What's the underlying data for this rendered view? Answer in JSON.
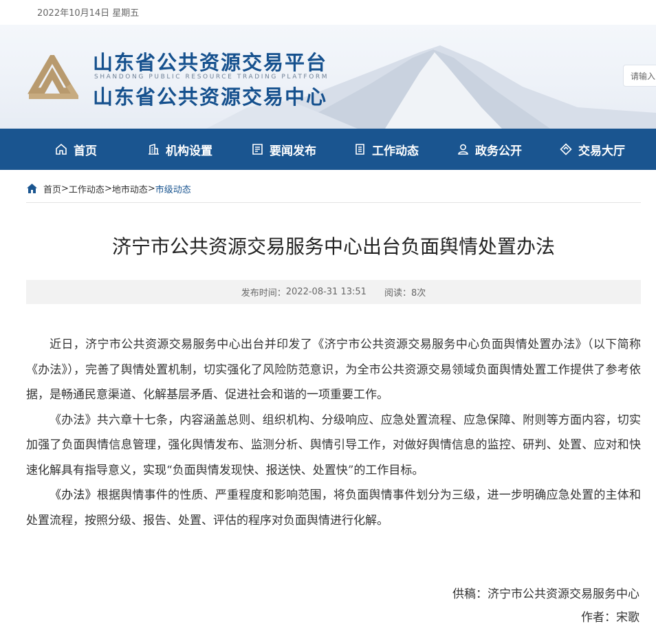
{
  "topbar": {
    "date": "2022年10月14日 星期五"
  },
  "header": {
    "title_cn_1": "山东省公共资源交易平台",
    "title_en": "SHANDONG PUBLIC RESOURCE TRADING PLATFORM",
    "title_cn_2": "山东省公共资源交易中心",
    "search_placeholder": "请输入"
  },
  "nav": {
    "items": [
      {
        "label": "首页",
        "icon": "home-icon"
      },
      {
        "label": "机构设置",
        "icon": "building-icon"
      },
      {
        "label": "要闻发布",
        "icon": "news-icon"
      },
      {
        "label": "工作动态",
        "icon": "document-icon"
      },
      {
        "label": "政务公开",
        "icon": "user-icon"
      },
      {
        "label": "交易大厅",
        "icon": "diamond-icon"
      }
    ]
  },
  "breadcrumb": {
    "items": [
      "首页",
      "工作动态",
      "地市动态",
      "市级动态"
    ],
    "separator": ">"
  },
  "article": {
    "title": "济宁市公共资源交易服务中心出台负面舆情处置办法",
    "publish_label": "发布时间：",
    "publish_time": "2022-08-31 13:51",
    "reads_label": "阅读：",
    "reads_count": "8次",
    "paragraphs": [
      {
        "text": "近日，济宁市公共资源交易服务中心出台并印发了《济宁市公共资源交易服务中心负面舆情处置办法》（以下简称《办法》），完善了舆情处置机制，切实强化了风险防范意识，为全市公共资源交易领域负面舆情处置工作提供了参考依据，是畅通民意渠道、化解基层矛盾、促进社会和谐的一项重要工作。"
      },
      {
        "text_a": "《办法》共六章十七条，内容涵盖总则、组织机构、分级响应、应急处置流程、应急保障、附则等方面内容，切实加强了负面舆情信息管理，强化舆情发布、监测分析、舆情引导工作，对做好舆情信息的监控、研判、处置、应对和快速化解具有指导意义，",
        "bold": "实现",
        "text_b": "“负面舆情发现快、报送快、处置快”的工作目标。"
      },
      {
        "lead": "《办法》",
        "text": "根据舆情事件的性质、严重程度和影响范围，将负面舆情事件划分为三级，进一步明确应急处置的主体和处置流程，按照分级、报告、处置、评估的程序对负面舆情进行化解。"
      }
    ],
    "source_line": "供稿：济宁市公共资源交易服务中心",
    "author_line": "作者：宋歌"
  },
  "colors": {
    "brand_blue": "#1a5590",
    "title_blue": "#16518e",
    "logo_gold": "#b89a6e"
  }
}
